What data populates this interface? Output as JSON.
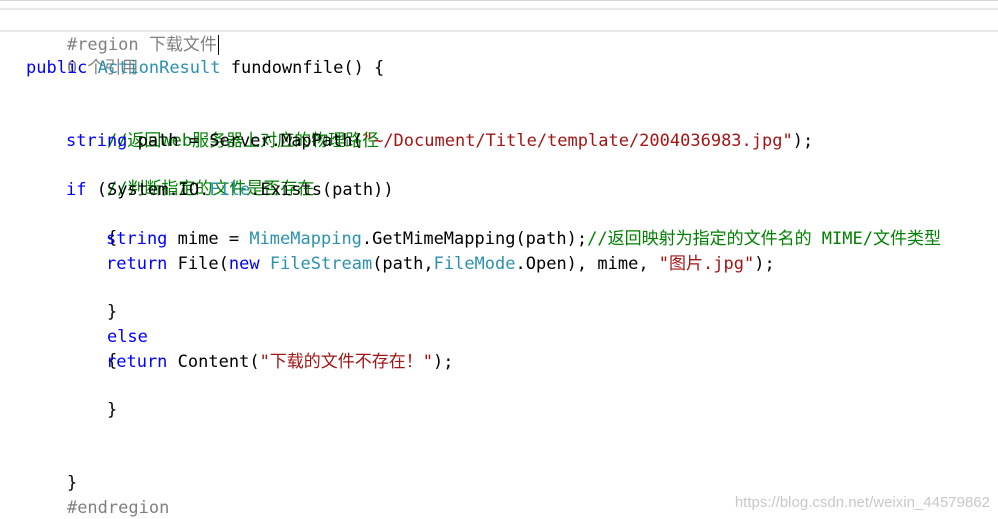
{
  "editor": {
    "region_start": "#region 下载文件",
    "codelens": "0 个引用",
    "method_keyword": "public",
    "method_return_type": "ActionResult",
    "method_signature": "fundownfile() {",
    "comment1": "//返回Web服务器上对应的物理路径",
    "path_decl_kw": "string",
    "path_decl_mid": "path = Server.MapPath(",
    "path_string": "\"~/Document/Title/template/2004036983.jpg\"",
    "path_decl_end": ");",
    "comment2": "//判断指定的文件是否存在",
    "if_kw": "if",
    "if_mid1": "(System.IO.",
    "if_type": "File",
    "if_mid2": ".Exists(path))",
    "open_brace": "{",
    "close_brace": "}",
    "mime_kw": "string",
    "mime_mid": "mime = ",
    "mime_type": "MimeMapping",
    "mime_call": ".GetMimeMapping(path);",
    "mime_comment": "//返回映射为指定的文件名的 MIME/文件类型",
    "return_kw": "return",
    "return_file": "File(",
    "new_kw": "new",
    "filestream_type": "FileStream",
    "return_mid": "(path,",
    "filemode_type": "FileMode",
    "return_mid2": ".Open), mime, ",
    "return_str": "\"图片.jpg\"",
    "return_end": ");",
    "else_kw": "else",
    "return2_kw": "return",
    "content_call": "Content(",
    "content_str": "\"下载的文件不存在！\"",
    "content_end": ");",
    "method_close": "}",
    "region_end": "#endregion"
  },
  "colors": {
    "keyword": "#0000ff",
    "type": "#2b91af",
    "comment": "#008000",
    "string": "#a31515",
    "region": "#808080"
  },
  "watermark": "https://blog.csdn.net/weixin_44579862"
}
